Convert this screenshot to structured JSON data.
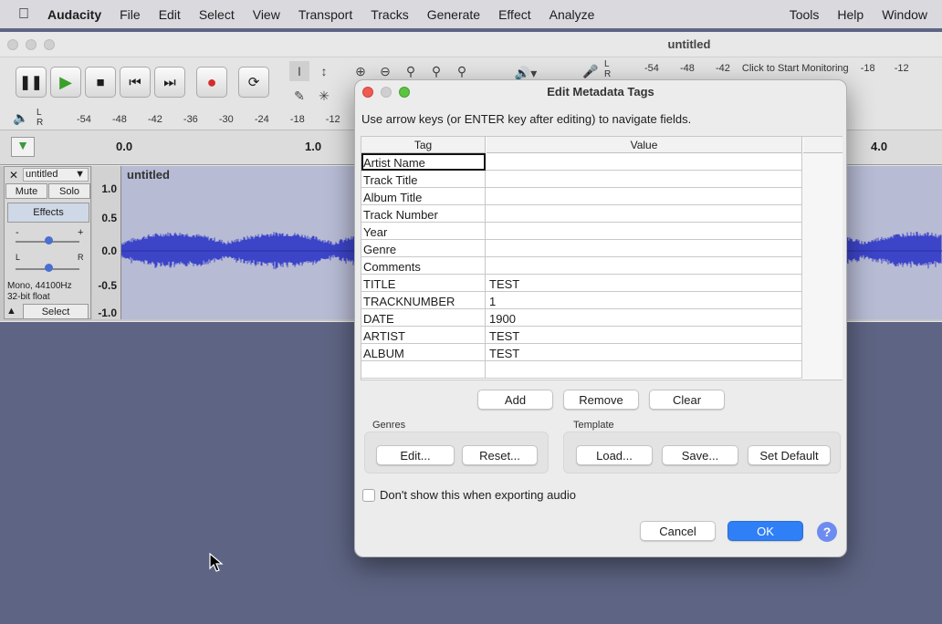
{
  "menubar": {
    "app": "Audacity",
    "items": [
      "File",
      "Edit",
      "Select",
      "View",
      "Transport",
      "Tracks",
      "Generate",
      "Effect",
      "Analyze"
    ],
    "right_items": [
      "Tools",
      "Help",
      "Window"
    ]
  },
  "window": {
    "title": "untitled"
  },
  "meters": {
    "record_ticks": [
      "-54",
      "-48",
      "-42"
    ],
    "record_hint": "Click to Start Monitoring",
    "record_ticks_right": [
      "-18",
      "-12"
    ],
    "play_ticks": [
      "-54",
      "-48",
      "-42",
      "-36",
      "-30",
      "-24",
      "-18",
      "-12"
    ],
    "lr": [
      "L",
      "R"
    ]
  },
  "timeline": {
    "ticks": [
      "0.0",
      "1.0",
      "4.0"
    ]
  },
  "track": {
    "name": "untitled",
    "mute": "Mute",
    "solo": "Solo",
    "effects": "Effects",
    "gain_minus": "-",
    "gain_plus": "+",
    "pan_l": "L",
    "pan_r": "R",
    "info_line1": "Mono, 44100Hz",
    "info_line2": "32-bit float",
    "select": "Select",
    "clip_name": "untitled",
    "scale": [
      "1.0",
      "0.5",
      "0.0",
      "-0.5",
      "-1.0"
    ]
  },
  "dialog": {
    "title": "Edit Metadata Tags",
    "instructions": "Use arrow keys (or ENTER key after editing) to navigate fields.",
    "col_tag": "Tag",
    "col_value": "Value",
    "rows": [
      {
        "tag": "Artist Name",
        "value": ""
      },
      {
        "tag": "Track Title",
        "value": ""
      },
      {
        "tag": "Album Title",
        "value": ""
      },
      {
        "tag": "Track Number",
        "value": ""
      },
      {
        "tag": "Year",
        "value": ""
      },
      {
        "tag": "Genre",
        "value": ""
      },
      {
        "tag": "Comments",
        "value": ""
      },
      {
        "tag": "TITLE",
        "value": "TEST"
      },
      {
        "tag": "TRACKNUMBER",
        "value": "1"
      },
      {
        "tag": "DATE",
        "value": "1900"
      },
      {
        "tag": "ARTIST",
        "value": "TEST"
      },
      {
        "tag": "ALBUM",
        "value": "TEST"
      },
      {
        "tag": "",
        "value": ""
      }
    ],
    "add": "Add",
    "remove": "Remove",
    "clear": "Clear",
    "genres_label": "Genres",
    "genres_edit": "Edit...",
    "genres_reset": "Reset...",
    "template_label": "Template",
    "template_load": "Load...",
    "template_save": "Save...",
    "template_default": "Set Default",
    "dont_show": "Don't show this when exporting audio",
    "cancel": "Cancel",
    "ok": "OK",
    "help": "?"
  },
  "colors": {
    "accent": "#2f7ff6",
    "waveform": "#3c44c8",
    "desktop": "#5e6584"
  }
}
